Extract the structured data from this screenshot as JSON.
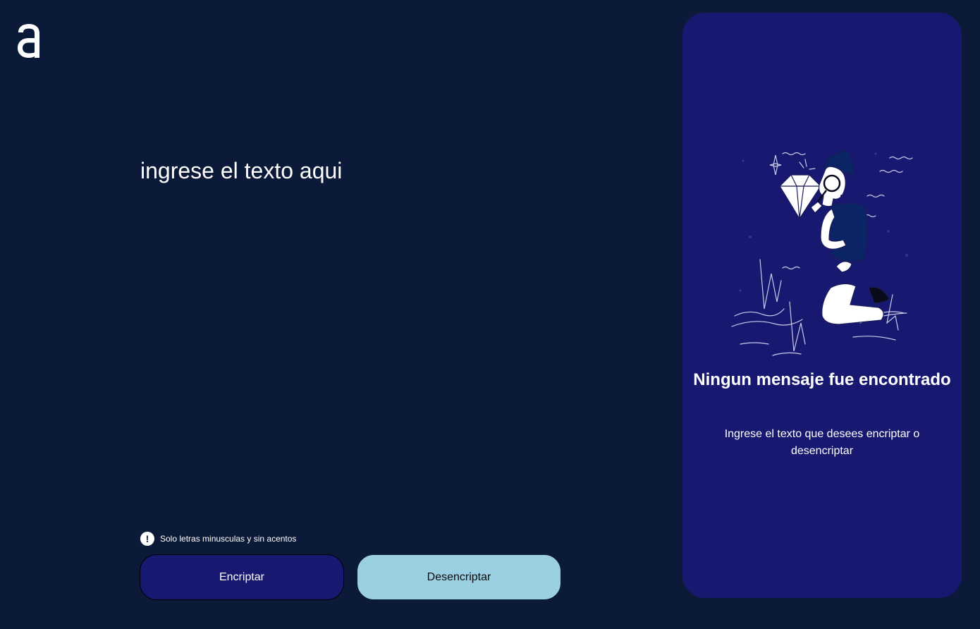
{
  "app": {
    "logo_icon": "alura-a-logo-icon"
  },
  "input": {
    "placeholder": "ingrese el texto aqui",
    "value": ""
  },
  "hint": {
    "icon": "exclamation-circle-icon",
    "text": "Solo letras minusculas y sin acentos"
  },
  "actions": {
    "encrypt_label": "Encriptar",
    "decrypt_label": "Desencriptar"
  },
  "output_panel": {
    "illustration": "person-with-magnifying-glass-and-diamond",
    "title": "Ningun mensaje fue encontrado",
    "description": "Ingrese el texto que desees encriptar o desencriptar"
  },
  "colors": {
    "background": "#0b1a38",
    "panel": "#171971",
    "encrypt_button": "#171971",
    "decrypt_button": "#9bcfe2",
    "text": "#ffffff"
  }
}
